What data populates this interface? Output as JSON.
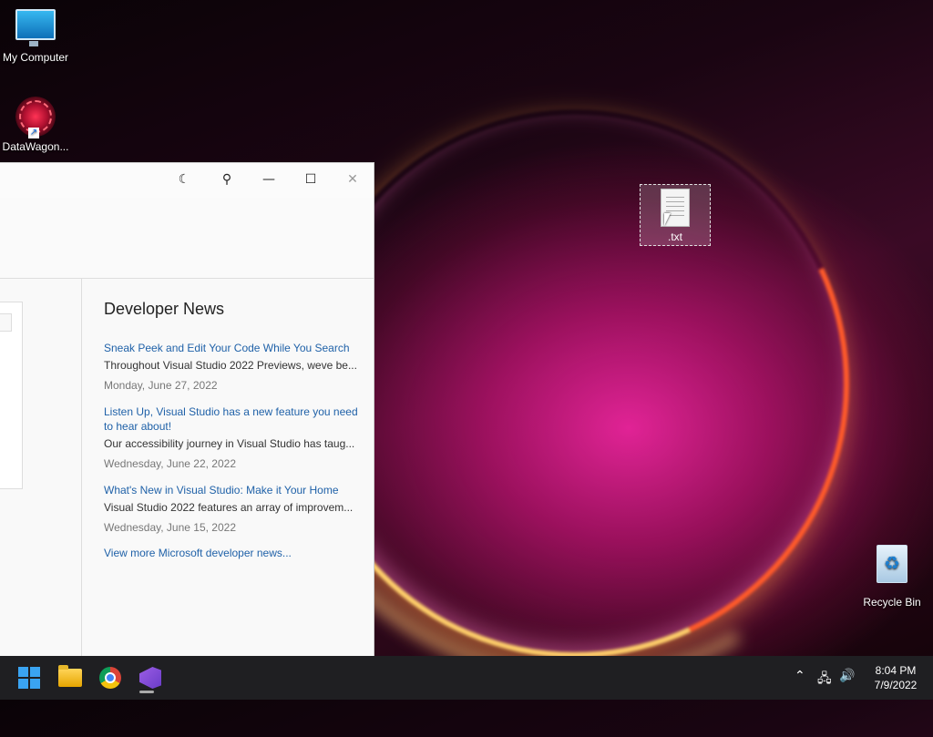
{
  "desktop": {
    "icons": {
      "my_computer": "My Computer",
      "datawagon": "DataWagon...",
      "txt_file": ".txt",
      "recycle_bin": "Recycle Bin"
    }
  },
  "window": {
    "controls": {
      "theme": "☾",
      "feedback": "⚲",
      "minimize": "—",
      "maximize": "☐",
      "close": "✕"
    },
    "news": {
      "title": "Developer News",
      "items": [
        {
          "title": "Sneak Peek and Edit Your Code While You Search",
          "desc": "Throughout Visual Studio 2022 Previews, weve be...",
          "date": "Monday, June 27, 2022"
        },
        {
          "title": "Listen Up, Visual Studio has a new feature you need to hear about!",
          "desc": "Our accessibility journey in Visual Studio has taug...",
          "date": "Wednesday, June 22, 2022"
        },
        {
          "title": "What's New in Visual Studio: Make it Your Home",
          "desc": "Visual Studio 2022 features an array of improvem...",
          "date": "Wednesday, June 15, 2022"
        }
      ],
      "more_link": "View more Microsoft developer news..."
    }
  },
  "taskbar": {
    "tray": {
      "chevron": "⌃",
      "network": "🖧",
      "volume": "🔊"
    },
    "clock": {
      "time": "8:04 PM",
      "date": "7/9/2022"
    }
  },
  "colors": {
    "accent": "#1f61a8",
    "taskbar": "#1f1f22"
  }
}
